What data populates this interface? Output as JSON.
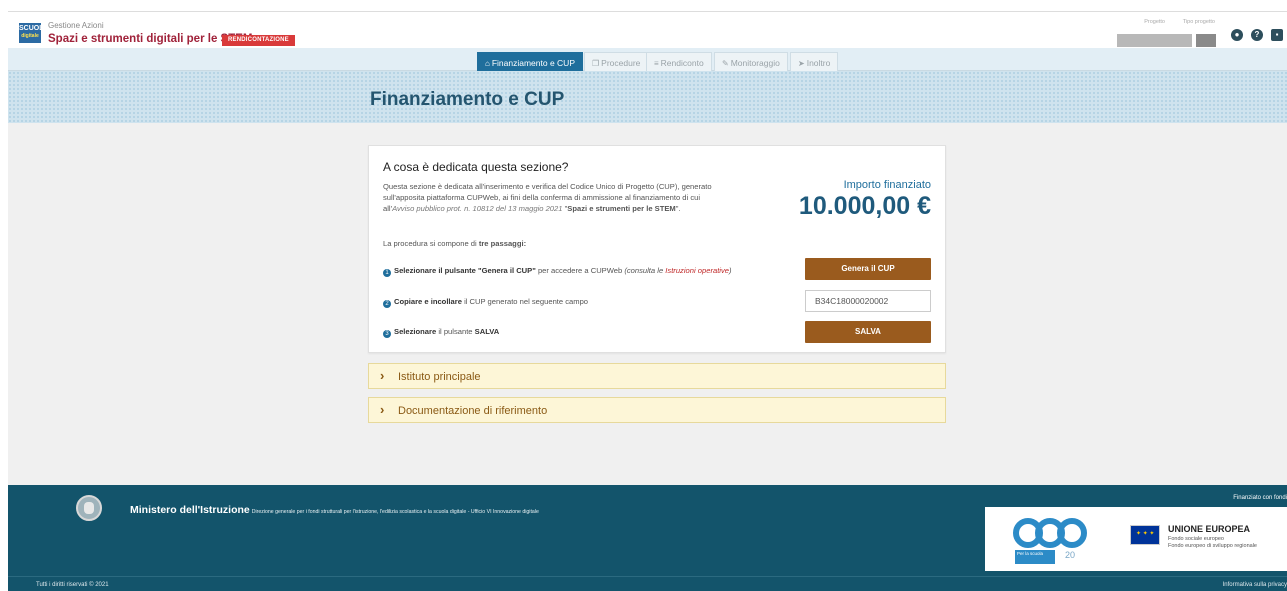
{
  "header": {
    "logo_line1": "SCUOLA",
    "logo_line2": "digitale",
    "subtitle": "Gestione Azioni",
    "title": "Spazi e strumenti digitali per le STEM",
    "badge": "RENDICONTAZIONE",
    "project_label": "Progetto",
    "type_label": "Tipo progetto",
    "icons": [
      "user-icon",
      "help-icon",
      "notification-icon"
    ]
  },
  "nav": {
    "tabs": [
      {
        "label": "Finanziamento e CUP",
        "icon": "home-icon",
        "active": true
      },
      {
        "label": "Procedure",
        "icon": "copy-icon",
        "active": false
      },
      {
        "label": "Rendiconto",
        "icon": "list-icon",
        "active": false
      },
      {
        "label": "Monitoraggio",
        "icon": "edit-icon",
        "active": false
      },
      {
        "label": "Inoltro",
        "icon": "send-icon",
        "active": false
      }
    ]
  },
  "banner": {
    "title": "Finanziamento e CUP"
  },
  "section": {
    "heading": "A cosa è dedicata questa sezione?",
    "desc_1": "Questa sezione è dedicata all'inserimento e verifica del Codice Unico di Progetto (CUP), generato sull'apposita piattaforma CUPWeb, ai fini della conferma di ammissione al finanziamento di cui all'",
    "desc_italic": "Avviso pubblico prot. n. 10812 del 13 maggio 2021",
    "desc_2": " \"",
    "desc_bold": "Spazi e strumenti per le STEM",
    "desc_3": "\".",
    "steps_intro_1": "La procedura si compone di ",
    "steps_intro_bold": "tre passaggi:",
    "step1_num": "1",
    "step1_bold": "Selezionare il pulsante \"Genera il CUP\"",
    "step1_text": " per accedere a CUPWeb ",
    "step1_italic": "(consulta le ",
    "step1_link": "Istruzioni operative",
    "step1_end": ")",
    "step2_num": "2",
    "step2_bold": "Copiare e incollare",
    "step2_text": " il CUP generato nel seguente campo",
    "step3_num": "3",
    "step3_bold": "Selezionare",
    "step3_text": " il pulsante ",
    "step3_bold2": "SALVA",
    "amount_label": "Importo finanziato",
    "amount": "10.000,00 €",
    "generate_button": "Genera il CUP",
    "cup_value": "B34C18000020002",
    "save_button": "SALVA"
  },
  "accordion": [
    {
      "label": "Istituto principale"
    },
    {
      "label": "Documentazione di riferimento"
    }
  ],
  "footer": {
    "ministry": "Ministero dell'Istruzione",
    "ministry_sub": "Direzione generale per i fondi strutturali per l'istruzione, l'edilizia scolastica e la scuola digitale - Ufficio VI Innovazione digitale",
    "funded": "Finanziato con fondi",
    "pon_caption": "Per la scuola",
    "pon_years": "20",
    "eu_title": "UNIONE EUROPEA",
    "eu_line1": "Fondo sociale europeo",
    "eu_line2": "Fondo europeo di sviluppo regionale",
    "rights": "Tutti i diritti riservati © 2021",
    "privacy": "Informativa sulla privacy"
  }
}
